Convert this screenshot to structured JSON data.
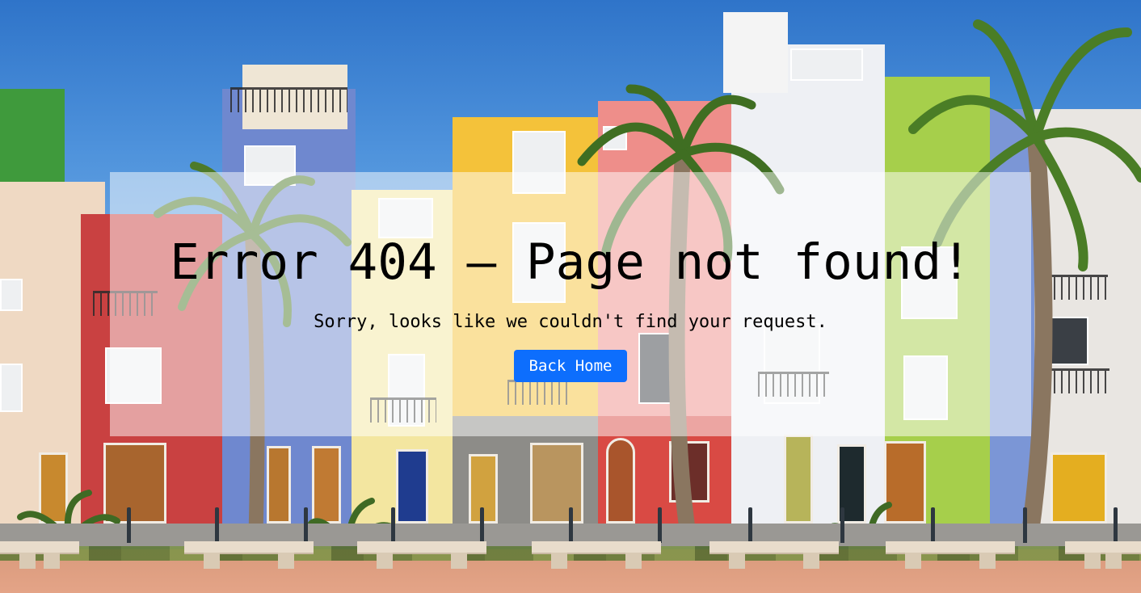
{
  "error": {
    "title": "Error 404 — Page not found!",
    "message": "Sorry, looks like we couldn't find your request.",
    "button_label": "Back Home"
  },
  "colors": {
    "button_bg": "#0d6efd",
    "button_text": "#ffffff",
    "overlay": "rgba(255,255,255,0.5)",
    "text": "#000000"
  },
  "background": {
    "subject": "colorful-seaside-houses-with-palm-trees"
  }
}
